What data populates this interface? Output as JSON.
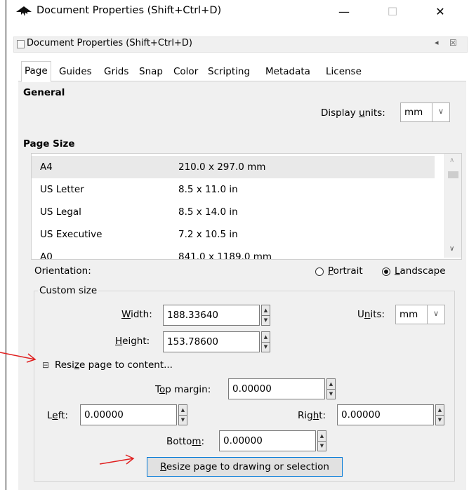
{
  "window": {
    "title": "Document Properties (Shift+Ctrl+D)",
    "minimize_glyph": "—",
    "maximize_glyph": "☐",
    "close_glyph": "✕"
  },
  "dock": {
    "title": "Document Properties (Shift+Ctrl+D)",
    "float_glyph": "◂",
    "close_glyph": "☒"
  },
  "tabs": [
    {
      "label": "Page",
      "active": true
    },
    {
      "label": "Guides"
    },
    {
      "label": "Grids"
    },
    {
      "label": "Snap"
    },
    {
      "label": "Color"
    },
    {
      "label": "Scripting"
    },
    {
      "label": "Metadata"
    },
    {
      "label": "License"
    }
  ],
  "general": {
    "heading": "General",
    "display_units_label_pre": "Display ",
    "display_units_label_u": "u",
    "display_units_label_post": "nits:",
    "display_units_value": "mm"
  },
  "page_size": {
    "heading": "Page Size",
    "rows": [
      {
        "name": "A4",
        "size": "210.0 x 297.0 mm",
        "selected": true
      },
      {
        "name": "US Letter",
        "size": "8.5 x 11.0 in"
      },
      {
        "name": "US Legal",
        "size": "8.5 x 14.0 in"
      },
      {
        "name": "US Executive",
        "size": "7.2 x 10.5 in"
      },
      {
        "name": "A0",
        "size": "841.0 x 1189.0 mm"
      }
    ]
  },
  "orientation": {
    "label": "Orientation:",
    "portrait_u": "P",
    "portrait_rest": "ortrait",
    "landscape_u": "L",
    "landscape_rest": "andscape",
    "selected": "landscape"
  },
  "custom_size": {
    "legend": "Custom size",
    "width_u": "W",
    "width_rest": "idth:",
    "width_value": "188.33640",
    "height_u": "H",
    "height_rest": "eight:",
    "height_value": "153.78600",
    "units_pre": "U",
    "units_u": "n",
    "units_post": "its:",
    "units_value": "mm"
  },
  "resize": {
    "expander_glyph": "⊟",
    "label_pre": "Resi",
    "label_u": "z",
    "label_post": "e page to content...",
    "top_pre": "T",
    "top_u": "o",
    "top_post": "p margin:",
    "top_value": "0.00000",
    "left_pre": "L",
    "left_u": "e",
    "left_post": "ft:",
    "left_value": "0.00000",
    "right_pre": "Rig",
    "right_u": "h",
    "right_post": "t:",
    "right_value": "0.00000",
    "bottom_pre": "Botto",
    "bottom_u": "m",
    "bottom_post": ":",
    "bottom_value": "0.00000",
    "button_u": "R",
    "button_rest": "esize page to drawing or selection"
  },
  "colors": {
    "annotation_arrow": "#e02020",
    "focus_border": "#0078d7"
  }
}
